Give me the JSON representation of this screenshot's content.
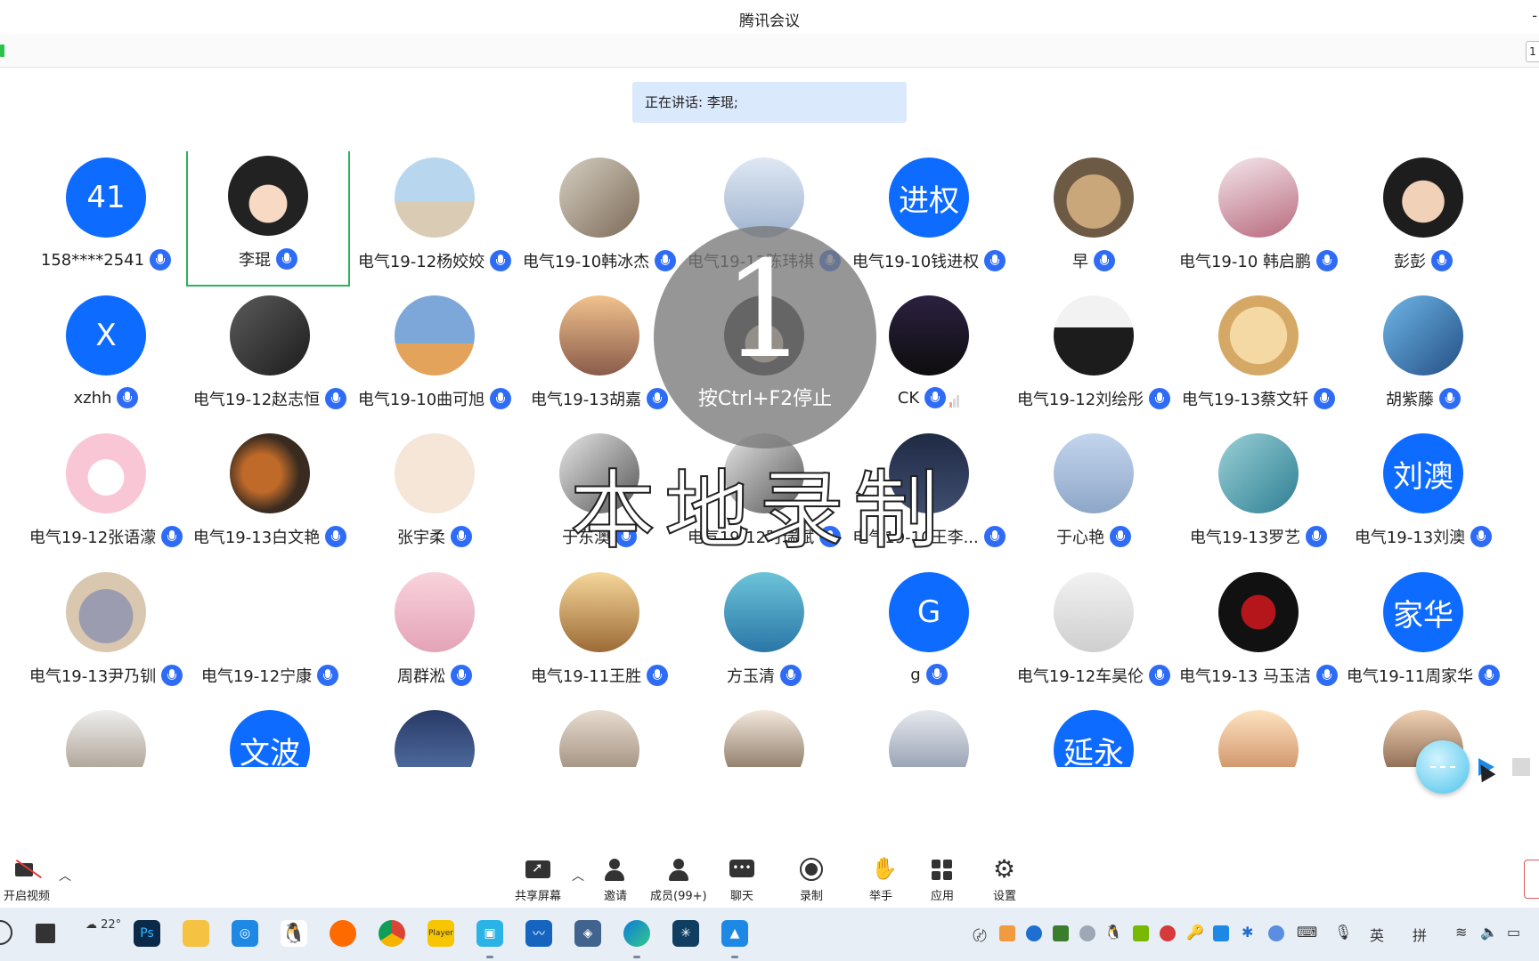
{
  "window": {
    "title": "腾讯会议",
    "minimize_glyph": "-",
    "right_edge_label": "1"
  },
  "speaking_banner": "正在讲话: 李琨;",
  "participants": [
    {
      "name": "158****2541",
      "avatar_text": "41",
      "avatar_style": "blue",
      "icon": "mic-icon"
    },
    {
      "name": "李琨",
      "avatar_text": "",
      "avatar_style": "p-man",
      "icon": "mic-icon",
      "active": true
    },
    {
      "name": "电气19-12杨姣姣",
      "avatar_text": "",
      "avatar_style": "p-beach",
      "icon": "mic-icon"
    },
    {
      "name": "电气19-10韩冰杰",
      "avatar_text": "",
      "avatar_style": "p-girl",
      "icon": "mic-icon"
    },
    {
      "name": "电气19-13陈玮祺",
      "avatar_text": "",
      "avatar_style": "p-sky",
      "icon": "mic-icon"
    },
    {
      "name": "电气19-10钱进权",
      "avatar_text": "进权",
      "avatar_style": "blue",
      "icon": "mic-icon"
    },
    {
      "name": "早",
      "avatar_text": "",
      "avatar_style": "p-cat",
      "icon": "mic-icon"
    },
    {
      "name": "电气19-10 韩启鹏",
      "avatar_text": "",
      "avatar_style": "p-anime",
      "icon": "mic-icon"
    },
    {
      "name": "彭彭",
      "avatar_text": "",
      "avatar_style": "p-boy",
      "icon": "mic-icon"
    },
    {
      "name": "xzhh",
      "avatar_text": "X",
      "avatar_style": "blue",
      "icon": "mic-icon"
    },
    {
      "name": "电气19-12赵志恒",
      "avatar_text": "",
      "avatar_style": "p-gym",
      "icon": "mic-icon"
    },
    {
      "name": "电气19-10曲可旭",
      "avatar_text": "",
      "avatar_style": "p-tom",
      "icon": "mic-icon"
    },
    {
      "name": "电气19-13胡嘉",
      "avatar_text": "",
      "avatar_style": "p-sunset",
      "icon": "mic-icon"
    },
    {
      "name": "",
      "avatar_text": "",
      "avatar_style": "p-man",
      "icon": "mic-icon",
      "hidden_label": true
    },
    {
      "name": "CK",
      "avatar_text": "",
      "avatar_style": "p-dark",
      "icon": "mic-icon",
      "signal": true
    },
    {
      "name": "电气19-12刘绘彤",
      "avatar_text": "",
      "avatar_style": "p-suit",
      "icon": "mic-icon"
    },
    {
      "name": "电气19-13蔡文轩",
      "avatar_text": "",
      "avatar_style": "p-cat2",
      "icon": "mic-icon"
    },
    {
      "name": "胡紫藤",
      "avatar_text": "",
      "avatar_style": "p-blue",
      "icon": "mic-icon"
    },
    {
      "name": "电气19-12张语濛",
      "avatar_text": "",
      "avatar_style": "p-pink",
      "icon": "mic-icon"
    },
    {
      "name": "电气19-13白文艳",
      "avatar_text": "",
      "avatar_style": "p-blur",
      "icon": "mic-icon"
    },
    {
      "name": "张宇柔",
      "avatar_text": "",
      "avatar_style": "p-fruit",
      "icon": "mic-icon"
    },
    {
      "name": "于东澳",
      "avatar_text": "",
      "avatar_style": "p-bw",
      "icon": "mic-icon"
    },
    {
      "name": "电气19-12时瑞斌",
      "avatar_text": "",
      "avatar_style": "p-bw",
      "icon": "mic-icon"
    },
    {
      "name": "电气19-10王李...",
      "avatar_text": "",
      "avatar_style": "p-crowd",
      "icon": "mic-icon"
    },
    {
      "name": "于心艳",
      "avatar_text": "",
      "avatar_style": "p-sky2",
      "icon": "mic-icon"
    },
    {
      "name": "电气19-13罗艺",
      "avatar_text": "",
      "avatar_style": "p-sea",
      "icon": "mic-icon"
    },
    {
      "name": "电气19-13刘澳",
      "avatar_text": "刘澳",
      "avatar_style": "blue",
      "icon": "mic-icon"
    },
    {
      "name": "电气19-13尹乃钏",
      "avatar_text": "",
      "avatar_style": "p-tomcat",
      "icon": "mic-icon"
    },
    {
      "name": "电气19-12宁康",
      "avatar_text": "",
      "avatar_style": "p-patrick",
      "icon": "mic-icon"
    },
    {
      "name": "周群淞",
      "avatar_text": "",
      "avatar_style": "p-pinkgirl",
      "icon": "mic-icon"
    },
    {
      "name": "电气19-11王胜",
      "avatar_text": "",
      "avatar_style": "p-deer",
      "icon": "mic-icon"
    },
    {
      "name": "方玉清",
      "avatar_text": "",
      "avatar_style": "p-wave",
      "icon": "mic-icon"
    },
    {
      "name": "g",
      "avatar_text": "G",
      "avatar_style": "blue",
      "icon": "mic-icon"
    },
    {
      "name": "电气19-12车昊伦",
      "avatar_text": "",
      "avatar_style": "p-car",
      "icon": "mic-icon"
    },
    {
      "name": "电气19-13 马玉洁",
      "avatar_text": "",
      "avatar_style": "p-rose",
      "icon": "mic-icon"
    },
    {
      "name": "电气19-11周家华",
      "avatar_text": "家华",
      "avatar_style": "blue",
      "icon": "mic-icon"
    },
    {
      "name": "",
      "avatar_text": "",
      "avatar_style": "p-cat3",
      "icon": "",
      "hidden_label": true
    },
    {
      "name": "",
      "avatar_text": "文波",
      "avatar_style": "blue",
      "icon": "",
      "hidden_label": true
    },
    {
      "name": "",
      "avatar_text": "",
      "avatar_style": "p-cartoon",
      "icon": "",
      "hidden_label": true
    },
    {
      "name": "",
      "avatar_text": "",
      "avatar_style": "p-dog",
      "icon": "",
      "hidden_label": true
    },
    {
      "name": "",
      "avatar_text": "",
      "avatar_style": "p-hat",
      "icon": "",
      "hidden_label": true
    },
    {
      "name": "",
      "avatar_text": "",
      "avatar_style": "p-knight",
      "icon": "",
      "hidden_label": true
    },
    {
      "name": "",
      "avatar_text": "延永",
      "avatar_style": "blue",
      "icon": "",
      "hidden_label": true
    },
    {
      "name": "",
      "avatar_text": "",
      "avatar_style": "p-doll",
      "icon": "",
      "hidden_label": true
    },
    {
      "name": "",
      "avatar_text": "",
      "avatar_style": "p-glasses",
      "icon": "",
      "hidden_label": true
    }
  ],
  "recording_overlay": {
    "countdown": "1",
    "hint": "按Ctrl+F2停止",
    "label": "本地录制"
  },
  "controls": {
    "video": "开启视频",
    "share": "共享屏幕",
    "invite": "邀请",
    "members": "成员(99+)",
    "chat": "聊天",
    "record": "录制",
    "raise_hand": "举手",
    "apps": "应用",
    "settings": "设置"
  },
  "taskbar": {
    "weather_temp": "22°",
    "tray_lang": "英",
    "tray_ime": "拼"
  },
  "colors": {
    "accent_blue": "#0e6bff",
    "active_border": "#2bb35a",
    "mic_blue": "#2f6cf6"
  }
}
